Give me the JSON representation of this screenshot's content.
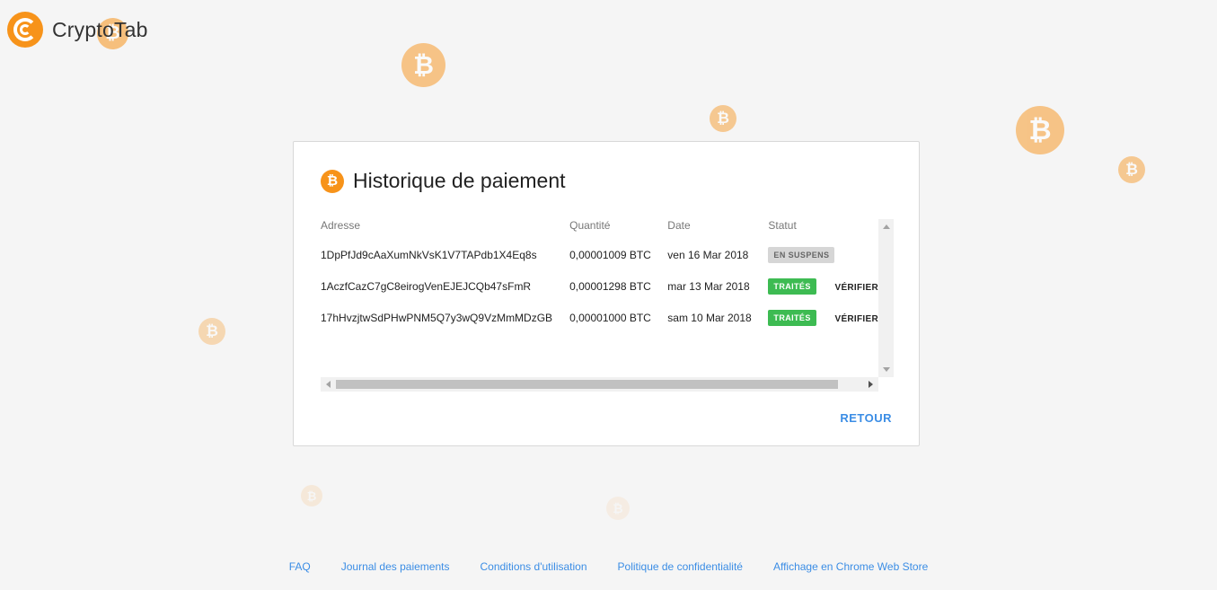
{
  "brand": {
    "name": "CryptoTab"
  },
  "coin_symbol": "₿",
  "colors": {
    "bitcoin_orange": "#f7931a",
    "link_blue": "#3b8de5",
    "success_green": "#3dbb52",
    "pending_gray": "#d6d6d6"
  },
  "card": {
    "title": "Historique de paiement",
    "columns": [
      "Adresse",
      "Quantité",
      "Date",
      "Statut"
    ],
    "rows": [
      {
        "address": "1DpPfJd9cAaXumNkVsK1V7TAPdb1X4Eq8s",
        "amount": "0,00001009 BTC",
        "date": "ven 16 Mar 2018",
        "status": "EN SUSPENS",
        "action": ""
      },
      {
        "address": "1AczfCazC7gC8eirogVenEJEJCQb47sFmR",
        "amount": "0,00001298 BTC",
        "date": "mar 13 Mar 2018",
        "status": "TRAITÉS",
        "action": "VÉRIFIER"
      },
      {
        "address": "17hHvzjtwSdPHwPNM5Q7y3wQ9VzMmMDzGB",
        "amount": "0,00001000 BTC",
        "date": "sam 10 Mar 2018",
        "status": "TRAITÉS",
        "action": "VÉRIFIER"
      }
    ],
    "back_label": "RETOUR"
  },
  "footer": {
    "links": [
      "FAQ",
      "Journal des paiements",
      "Conditions d'utilisation",
      "Politique de confidentialité",
      "Affichage en Chrome Web Store"
    ]
  }
}
